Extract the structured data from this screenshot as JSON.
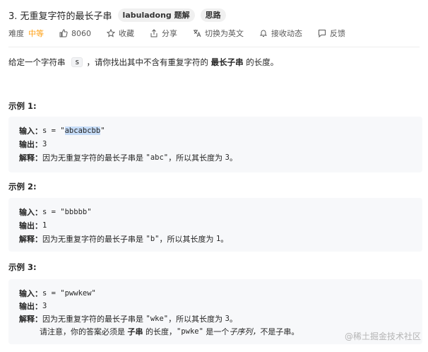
{
  "header": {
    "title": "3. 无重复字符的最长子串",
    "tag1": "labuladong 题解",
    "tag2": "思路"
  },
  "meta": {
    "difficulty_label": "难度",
    "difficulty": "中等",
    "likes": "8060",
    "favorite": "收藏",
    "share": "分享",
    "translate": "切换为英文",
    "notify": "接收动态",
    "feedback": "反馈"
  },
  "description": {
    "prefix": "给定一个字符串 ",
    "var": "s",
    "middle": "，请你找出其中不含有重复字符的 ",
    "bold": "最长子串",
    "suffix": " 的长度。"
  },
  "examples": [
    {
      "title": "示例 1:",
      "input_label": "输入：",
      "input_prefix": "s = \"",
      "input_value": "abcabcbb",
      "input_suffix": "\"",
      "output_label": "输出：",
      "output": "3",
      "explain_label": "解释：",
      "explain_text": "因为无重复字符的最长子串是 ",
      "explain_code": "\"abc\"",
      "explain_end": "，所以其长度为 ",
      "explain_num": "3",
      "explain_period": "。"
    },
    {
      "title": "示例 2:",
      "input_label": "输入：",
      "input": "s = \"bbbbb\"",
      "output_label": "输出：",
      "output": "1",
      "explain_label": "解释：",
      "explain_text": "因为无重复字符的最长子串是 ",
      "explain_code": "\"b\"",
      "explain_end": "，所以其长度为 ",
      "explain_num": "1",
      "explain_period": "。"
    },
    {
      "title": "示例 3:",
      "input_label": "输入：",
      "input": "s = \"pwwkew\"",
      "output_label": "输出：",
      "output": "3",
      "explain_label": "解释：",
      "explain_text": "因为无重复字符的最长子串是 ",
      "explain_code": "\"wke\"",
      "explain_end": "，所以其长度为 ",
      "explain_num": "3",
      "explain_period": "。",
      "note_prefix": "请注意，你的答案必须是 ",
      "note_bold": "子串",
      "note_mid": " 的长度，",
      "note_code": "\"pwke\"",
      "note_mid2": " 是一个",
      "note_italic": "子序列，",
      "note_end": "不是子串。"
    }
  ],
  "watermark": "@稀土掘金技术社区"
}
